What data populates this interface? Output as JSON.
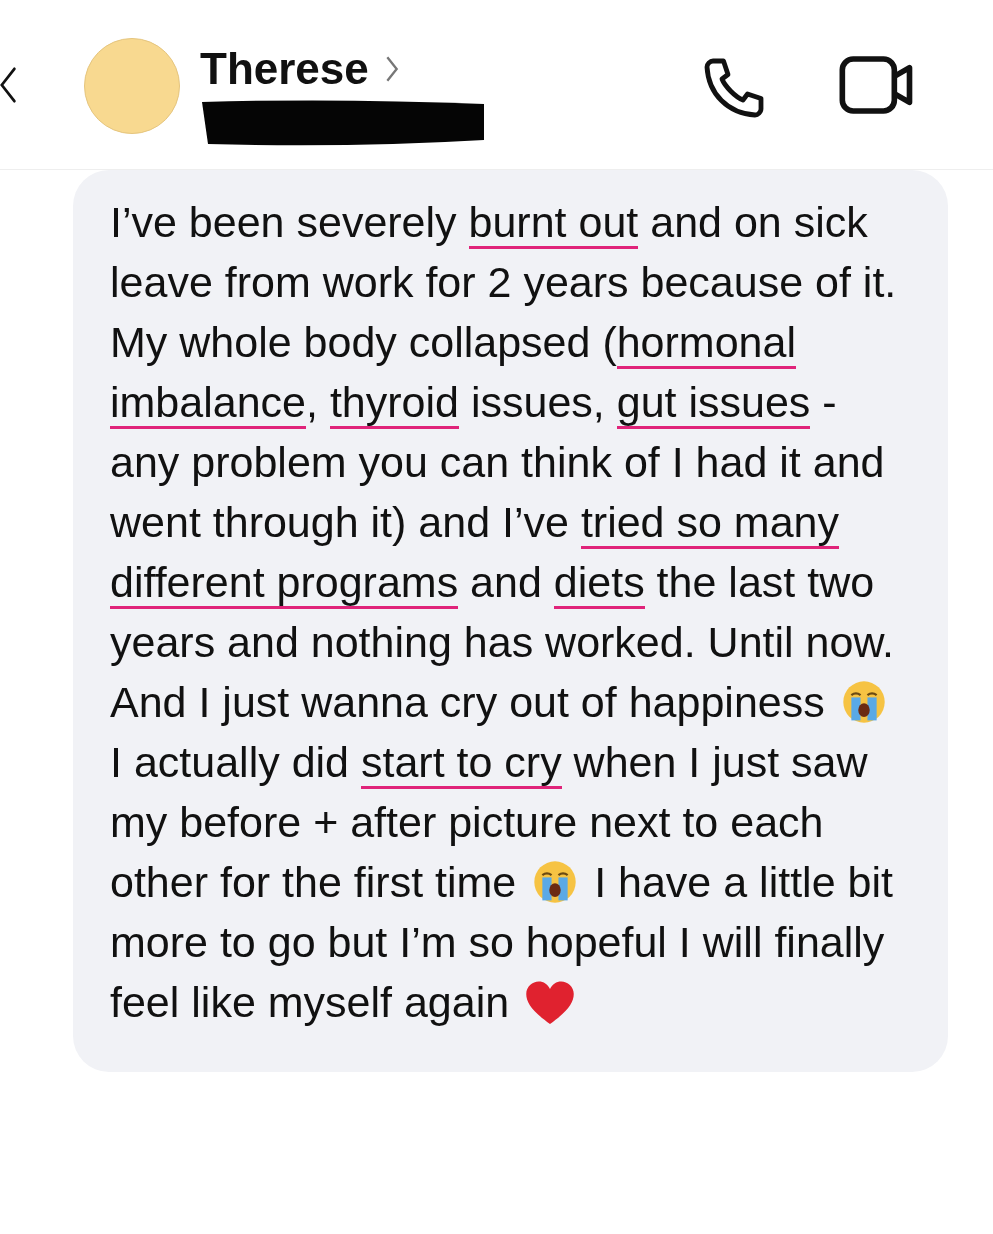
{
  "header": {
    "contact_name": "Therese"
  },
  "message": {
    "segments": [
      {
        "kind": "text",
        "text": "I’ve been severely ",
        "underlined": false
      },
      {
        "kind": "text",
        "text": "burnt out",
        "underlined": true
      },
      {
        "kind": "text",
        "text": " and on sick leave from work for 2 years because of it. My whole body collapsed (",
        "underlined": false
      },
      {
        "kind": "text",
        "text": "hormonal imbalance",
        "underlined": true
      },
      {
        "kind": "text",
        "text": ", ",
        "underlined": false
      },
      {
        "kind": "text",
        "text": "thyroid",
        "underlined": true
      },
      {
        "kind": "text",
        "text": " issues, ",
        "underlined": false
      },
      {
        "kind": "text",
        "text": "gut issues",
        "underlined": true
      },
      {
        "kind": "text",
        "text": " - any problem you can think of I had it and went through it) and I’ve ",
        "underlined": false
      },
      {
        "kind": "text",
        "text": "tried so",
        "underlined": true
      },
      {
        "kind": "text",
        "text": " many different programs",
        "underlined": true
      },
      {
        "kind": "text",
        "text": " and ",
        "underlined": false
      },
      {
        "kind": "text",
        "text": "diets",
        "underlined": true
      },
      {
        "kind": "text",
        "text": " the last two years and nothing has worked. Until now. And I just wanna cry out of happiness ",
        "underlined": false
      },
      {
        "kind": "crying_emoji"
      },
      {
        "kind": "text",
        "text": " I actually did ",
        "underlined": false
      },
      {
        "kind": "text",
        "text": "start to cry",
        "underlined": true
      },
      {
        "kind": "text",
        "text": " when I just saw my before + after picture next to each other for the first time ",
        "underlined": false
      },
      {
        "kind": "crying_emoji"
      },
      {
        "kind": "text",
        "text": " I have a little bit more to go but I’m so hopeful I will finally feel like myself again ",
        "underlined": false
      },
      {
        "kind": "heart_emoji"
      }
    ]
  }
}
